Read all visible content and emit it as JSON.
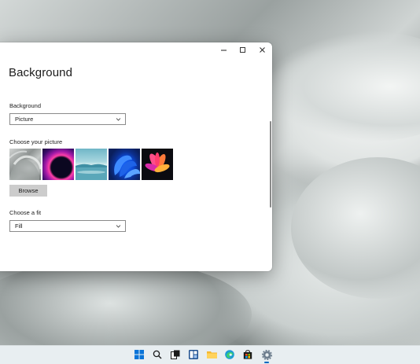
{
  "window": {
    "title": "Background",
    "controls": {
      "minimize": "—",
      "maximize": "▢",
      "close": "✕"
    }
  },
  "background_section": {
    "label": "Background",
    "selected": "Picture"
  },
  "picture_section": {
    "label": "Choose your picture",
    "thumbnails": [
      "wallpaper-grey-ribbon",
      "wallpaper-purple-glow",
      "wallpaper-lake",
      "wallpaper-blue-bloom",
      "wallpaper-pink-flower"
    ],
    "browse_label": "Browse"
  },
  "fit_section": {
    "label": "Choose a fit",
    "selected": "Fill"
  },
  "taskbar": {
    "icons": [
      "windows-start-icon",
      "search-icon",
      "task-view-icon",
      "widgets-icon",
      "file-explorer-icon",
      "edge-icon",
      "store-icon",
      "settings-icon"
    ],
    "active_app": "settings-icon"
  },
  "colors": {
    "accent": "#0067c0",
    "window_bg": "#ffffff",
    "taskbar_bg": "#e8eef1",
    "button_bg": "#cccccc"
  }
}
